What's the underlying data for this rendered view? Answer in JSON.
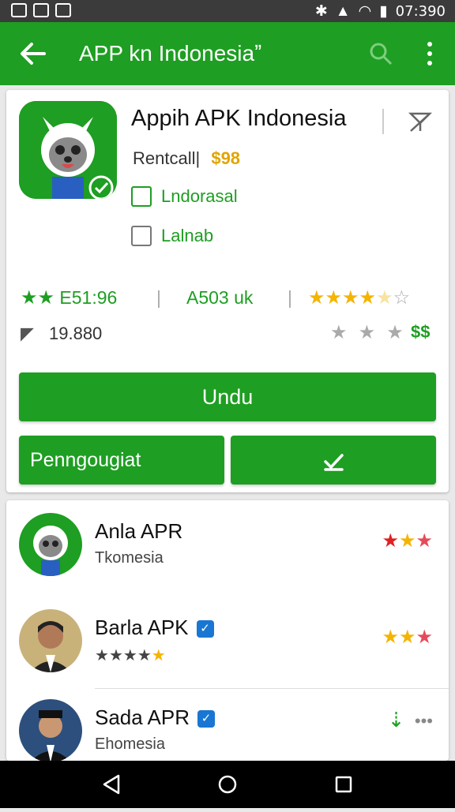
{
  "status": {
    "time": "07:390"
  },
  "appbar": {
    "title": "APP kn  Indonesiaˮ"
  },
  "app": {
    "name": "Appih APK Indonesia",
    "meta_label": "Rentcall|",
    "price": "$98",
    "info1": "Lndorasal",
    "info2": "Lalnab",
    "stat_rating": "E51:96",
    "stat_size": "A503 uk",
    "downloads": "19.880",
    "install_label": "Undu",
    "secondary_label": "Penngougiat"
  },
  "list": [
    {
      "name": "Anla APR",
      "sub": "Tkomesia"
    },
    {
      "name": "Barla APK",
      "sub": ""
    },
    {
      "name": "Sada APR",
      "sub": "Ehomesia"
    }
  ],
  "colors": {
    "brand": "#1e9e22",
    "statusbar": "#3b3b3b"
  }
}
